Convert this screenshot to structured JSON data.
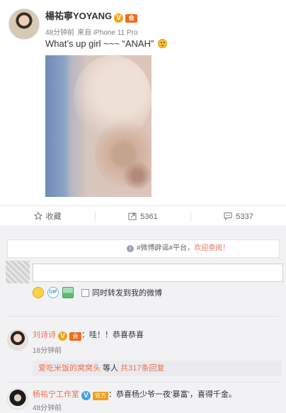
{
  "post": {
    "author": "楊祐寧YOYANG",
    "verified_icon": "V",
    "member_icon": "会",
    "time": "48分钟前",
    "source": "来自 iPhone 11 Pro",
    "text": "What’s up girl ~~~ “ANAH”",
    "emoji": "smile-emoji"
  },
  "actions": {
    "favorite": "收藏",
    "repost": "5361",
    "comment": "5337"
  },
  "notice": {
    "prefix": "#微博辟谣#平台，",
    "highlight": "欢迎查阅！"
  },
  "composer": {
    "placeholder": "",
    "gif_label": "GIF",
    "forward_label": "同时转发到我的微博"
  },
  "comments": [
    {
      "name": "刘诗诗",
      "text": "：哇！！恭喜恭喜",
      "time": "18分钟前",
      "reply_users": "爱吃米饭的窝窝头",
      "reply_mid": " 等人 ",
      "reply_count": "共317条回复"
    },
    {
      "name": "杨祐宁工作室",
      "member_badge": "官方",
      "text": "：恭喜杨少爷一夜‘暴富’，喜得千金。",
      "time": "48分钟前"
    }
  ],
  "colors": {
    "accent": "#eb7350",
    "link": "#eb7350",
    "background": "#f2f2f5"
  }
}
